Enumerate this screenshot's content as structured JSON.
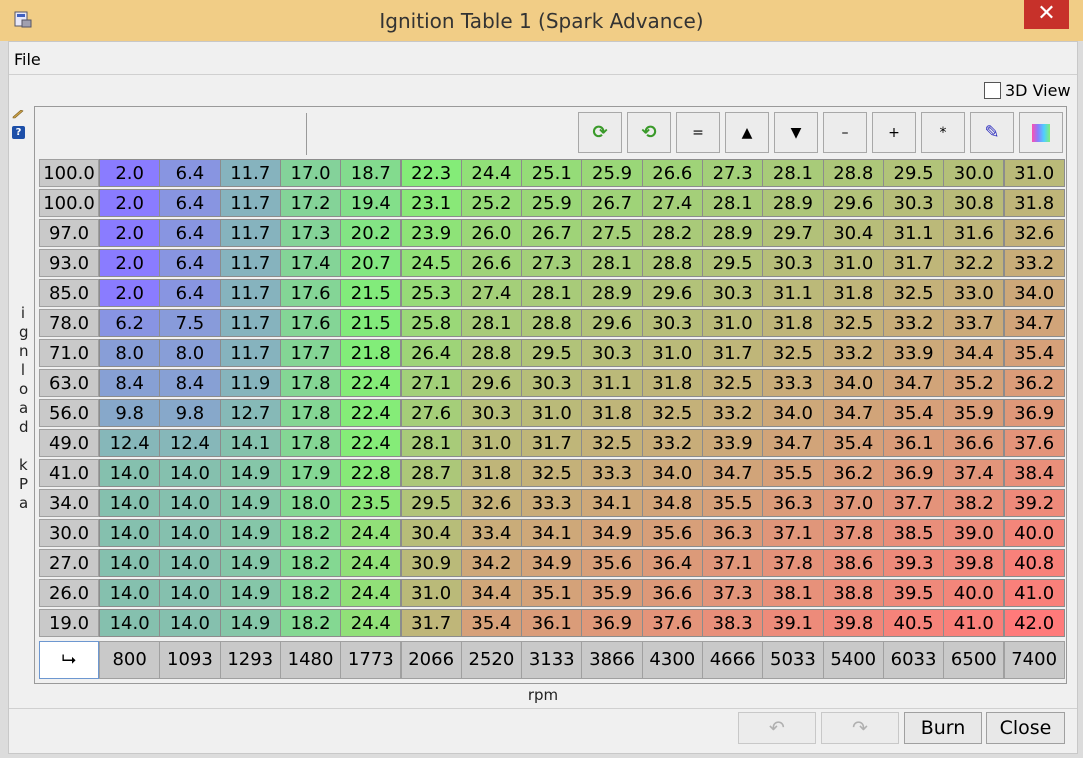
{
  "window": {
    "title": "Ignition Table 1 (Spark Advance)",
    "close_glyph": "✕"
  },
  "menu": {
    "file": "File"
  },
  "view3d": {
    "label": "3D View",
    "checked": false
  },
  "help_glyph": "?",
  "y_axis_label": [
    "i",
    "g",
    "n",
    "l",
    "o",
    "a",
    "d",
    "",
    "k",
    "P",
    "a"
  ],
  "x_axis_label": "rpm",
  "toolbar": [
    {
      "name": "rotate-up-icon",
      "glyph": "⟳",
      "color": "#3a9a2a"
    },
    {
      "name": "rotate-down-icon",
      "glyph": "⟲",
      "color": "#3a9a2a"
    },
    {
      "name": "set-equal-button",
      "glyph": "="
    },
    {
      "name": "increase-button",
      "glyph": "▲"
    },
    {
      "name": "decrease-button",
      "glyph": "▼"
    },
    {
      "name": "subtract-button",
      "glyph": "–"
    },
    {
      "name": "add-button",
      "glyph": "+"
    },
    {
      "name": "multiply-button",
      "glyph": "*"
    },
    {
      "name": "pencil-icon",
      "glyph": "✎",
      "color": "#3030c0"
    },
    {
      "name": "color-scale-icon",
      "glyph": ""
    }
  ],
  "table": {
    "load_bins": [
      "100.0",
      "100.0",
      "97.0",
      "93.0",
      "85.0",
      "78.0",
      "71.0",
      "63.0",
      "56.0",
      "49.0",
      "41.0",
      "34.0",
      "30.0",
      "27.0",
      "26.0",
      "19.0"
    ],
    "rpm_bins": [
      "800",
      "1093",
      "1293",
      "1480",
      "1773",
      "2066",
      "2520",
      "3133",
      "3866",
      "4300",
      "4666",
      "5033",
      "5400",
      "6033",
      "6500",
      "7400"
    ],
    "corner_glyph": "⮡",
    "values": [
      [
        "2.0",
        "6.4",
        "11.7",
        "17.0",
        "18.7",
        "22.3",
        "24.4",
        "25.1",
        "25.9",
        "26.6",
        "27.3",
        "28.1",
        "28.8",
        "29.5",
        "30.0",
        "31.0"
      ],
      [
        "2.0",
        "6.4",
        "11.7",
        "17.2",
        "19.4",
        "23.1",
        "25.2",
        "25.9",
        "26.7",
        "27.4",
        "28.1",
        "28.9",
        "29.6",
        "30.3",
        "30.8",
        "31.8"
      ],
      [
        "2.0",
        "6.4",
        "11.7",
        "17.3",
        "20.2",
        "23.9",
        "26.0",
        "26.7",
        "27.5",
        "28.2",
        "28.9",
        "29.7",
        "30.4",
        "31.1",
        "31.6",
        "32.6"
      ],
      [
        "2.0",
        "6.4",
        "11.7",
        "17.4",
        "20.7",
        "24.5",
        "26.6",
        "27.3",
        "28.1",
        "28.8",
        "29.5",
        "30.3",
        "31.0",
        "31.7",
        "32.2",
        "33.2"
      ],
      [
        "2.0",
        "6.4",
        "11.7",
        "17.6",
        "21.5",
        "25.3",
        "27.4",
        "28.1",
        "28.9",
        "29.6",
        "30.3",
        "31.1",
        "31.8",
        "32.5",
        "33.0",
        "34.0"
      ],
      [
        "6.2",
        "7.5",
        "11.7",
        "17.6",
        "21.5",
        "25.8",
        "28.1",
        "28.8",
        "29.6",
        "30.3",
        "31.0",
        "31.8",
        "32.5",
        "33.2",
        "33.7",
        "34.7"
      ],
      [
        "8.0",
        "8.0",
        "11.7",
        "17.7",
        "21.8",
        "26.4",
        "28.8",
        "29.5",
        "30.3",
        "31.0",
        "31.7",
        "32.5",
        "33.2",
        "33.9",
        "34.4",
        "35.4"
      ],
      [
        "8.4",
        "8.4",
        "11.9",
        "17.8",
        "22.4",
        "27.1",
        "29.6",
        "30.3",
        "31.1",
        "31.8",
        "32.5",
        "33.3",
        "34.0",
        "34.7",
        "35.2",
        "36.2"
      ],
      [
        "9.8",
        "9.8",
        "12.7",
        "17.8",
        "22.4",
        "27.6",
        "30.3",
        "31.0",
        "31.8",
        "32.5",
        "33.2",
        "34.0",
        "34.7",
        "35.4",
        "35.9",
        "36.9"
      ],
      [
        "12.4",
        "12.4",
        "14.1",
        "17.8",
        "22.4",
        "28.1",
        "31.0",
        "31.7",
        "32.5",
        "33.2",
        "33.9",
        "34.7",
        "35.4",
        "36.1",
        "36.6",
        "37.6"
      ],
      [
        "14.0",
        "14.0",
        "14.9",
        "17.9",
        "22.8",
        "28.7",
        "31.8",
        "32.5",
        "33.3",
        "34.0",
        "34.7",
        "35.5",
        "36.2",
        "36.9",
        "37.4",
        "38.4"
      ],
      [
        "14.0",
        "14.0",
        "14.9",
        "18.0",
        "23.5",
        "29.5",
        "32.6",
        "33.3",
        "34.1",
        "34.8",
        "35.5",
        "36.3",
        "37.0",
        "37.7",
        "38.2",
        "39.2"
      ],
      [
        "14.0",
        "14.0",
        "14.9",
        "18.2",
        "24.4",
        "30.4",
        "33.4",
        "34.1",
        "34.9",
        "35.6",
        "36.3",
        "37.1",
        "37.8",
        "38.5",
        "39.0",
        "40.0"
      ],
      [
        "14.0",
        "14.0",
        "14.9",
        "18.2",
        "24.4",
        "30.9",
        "34.2",
        "34.9",
        "35.6",
        "36.4",
        "37.1",
        "37.8",
        "38.6",
        "39.3",
        "39.8",
        "40.8"
      ],
      [
        "14.0",
        "14.0",
        "14.9",
        "18.2",
        "24.4",
        "31.0",
        "34.4",
        "35.1",
        "35.9",
        "36.6",
        "37.3",
        "38.1",
        "38.8",
        "39.5",
        "40.0",
        "41.0"
      ],
      [
        "14.0",
        "14.0",
        "14.9",
        "18.2",
        "24.4",
        "31.7",
        "35.4",
        "36.1",
        "36.9",
        "37.6",
        "38.3",
        "39.1",
        "39.8",
        "40.5",
        "41.0",
        "42.0"
      ]
    ],
    "color_scale": {
      "min": 2.0,
      "max": 42.0,
      "low": "#8a7cff",
      "mid": "#82ee78",
      "high": "#ff7a7a"
    }
  },
  "buttons": {
    "undo_glyph": "↶",
    "redo_glyph": "↷",
    "burn": "Burn",
    "close": "Close"
  }
}
